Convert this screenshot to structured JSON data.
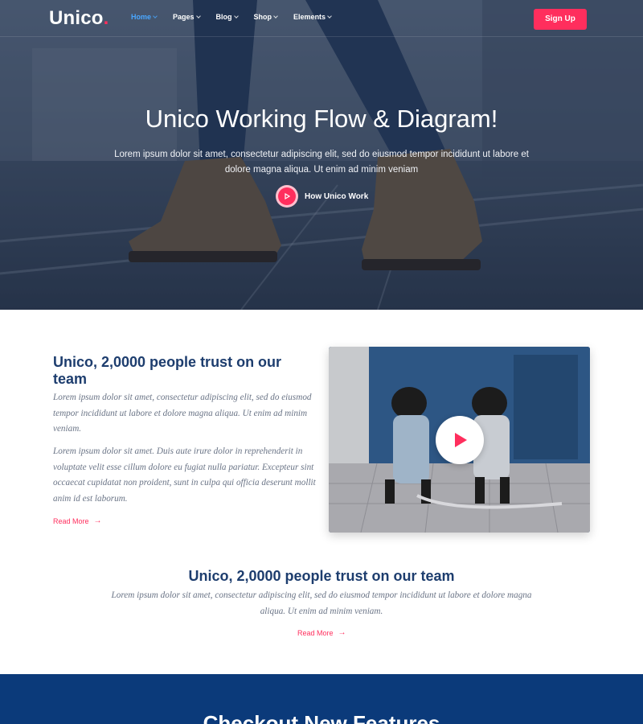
{
  "nav": {
    "logo": "Unico",
    "logo_dot": ".",
    "items": [
      {
        "label": "Home",
        "active": true
      },
      {
        "label": "Pages",
        "active": false
      },
      {
        "label": "Blog",
        "active": false
      },
      {
        "label": "Shop",
        "active": false
      },
      {
        "label": "Elements",
        "active": false
      }
    ],
    "signup_label": "Sign Up"
  },
  "hero": {
    "title": "Unico Working Flow & Diagram!",
    "subtitle": "Lorem ipsum dolor sit amet, consectetur adipiscing elit, sed do eiusmod tempor incididunt ut labore et dolore magna aliqua. Ut enim ad minim veniam",
    "cta_label": "How Unico Work"
  },
  "about": {
    "title": "Unico, 2,0000 people trust on our team",
    "paragraph1": "Lorem ipsum dolor sit amet, consectetur adipiscing elit, sed do eiusmod tempor incididunt ut labore et dolore magna aliqua. Ut enim ad minim veniam.",
    "paragraph2": "Lorem ipsum dolor sit amet. Duis aute irure dolor in reprehenderit in voluptate velit esse cillum dolore eu fugiat nulla pariatur. Excepteur sint occaecat cupidatat non proident, sunt in culpa qui officia deserunt mollit anim id est laborum.",
    "read_more": "Read More"
  },
  "center": {
    "title": "Unico, 2,0000 people trust on our team",
    "paragraph": "Lorem ipsum dolor sit amet, consectetur adipiscing elit, sed do eiusmod tempor incididunt ut labore et dolore magna aliqua. Ut enim ad minim veniam.",
    "read_more": "Read More"
  },
  "features": {
    "title": "Checkout New Features"
  },
  "colors": {
    "accent": "#ff2e5d",
    "heading": "#1d3d6e",
    "nav_active": "#4aa6ff",
    "features_bg": "#0b3a7a"
  },
  "icons": {
    "hero_play": "play-icon",
    "video_play": "play-icon",
    "read_more_arrow": "arrow-right-icon"
  }
}
